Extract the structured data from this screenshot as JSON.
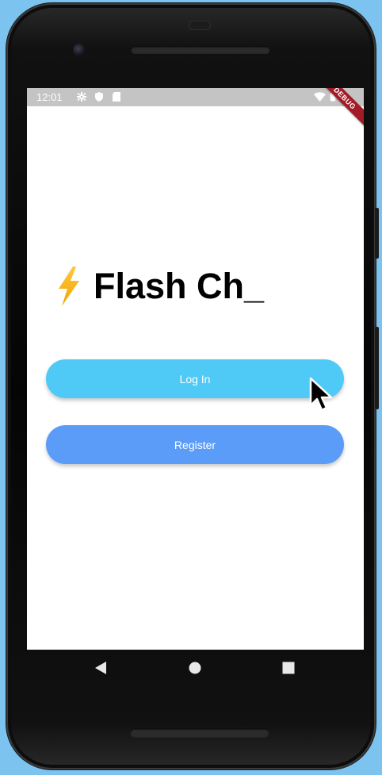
{
  "status_bar": {
    "time": "12:01",
    "left_icons": [
      "gear-icon",
      "shield-icon",
      "sd-card-icon"
    ],
    "right_icons": [
      "wifi-icon",
      "battery-icon"
    ],
    "debug_banner": "DEBUG"
  },
  "app": {
    "title_icon": "lightning-bolt-icon",
    "title": "Flash Ch_",
    "login_label": "Log In",
    "register_label": "Register"
  },
  "colors": {
    "login_button": "#4fcaf7",
    "register_button": "#5b9cf8",
    "debug_ribbon": "#a31b27",
    "background": "#7cc4ef"
  },
  "nav_bar": {
    "buttons": [
      "back-icon",
      "home-icon",
      "recents-icon"
    ]
  }
}
